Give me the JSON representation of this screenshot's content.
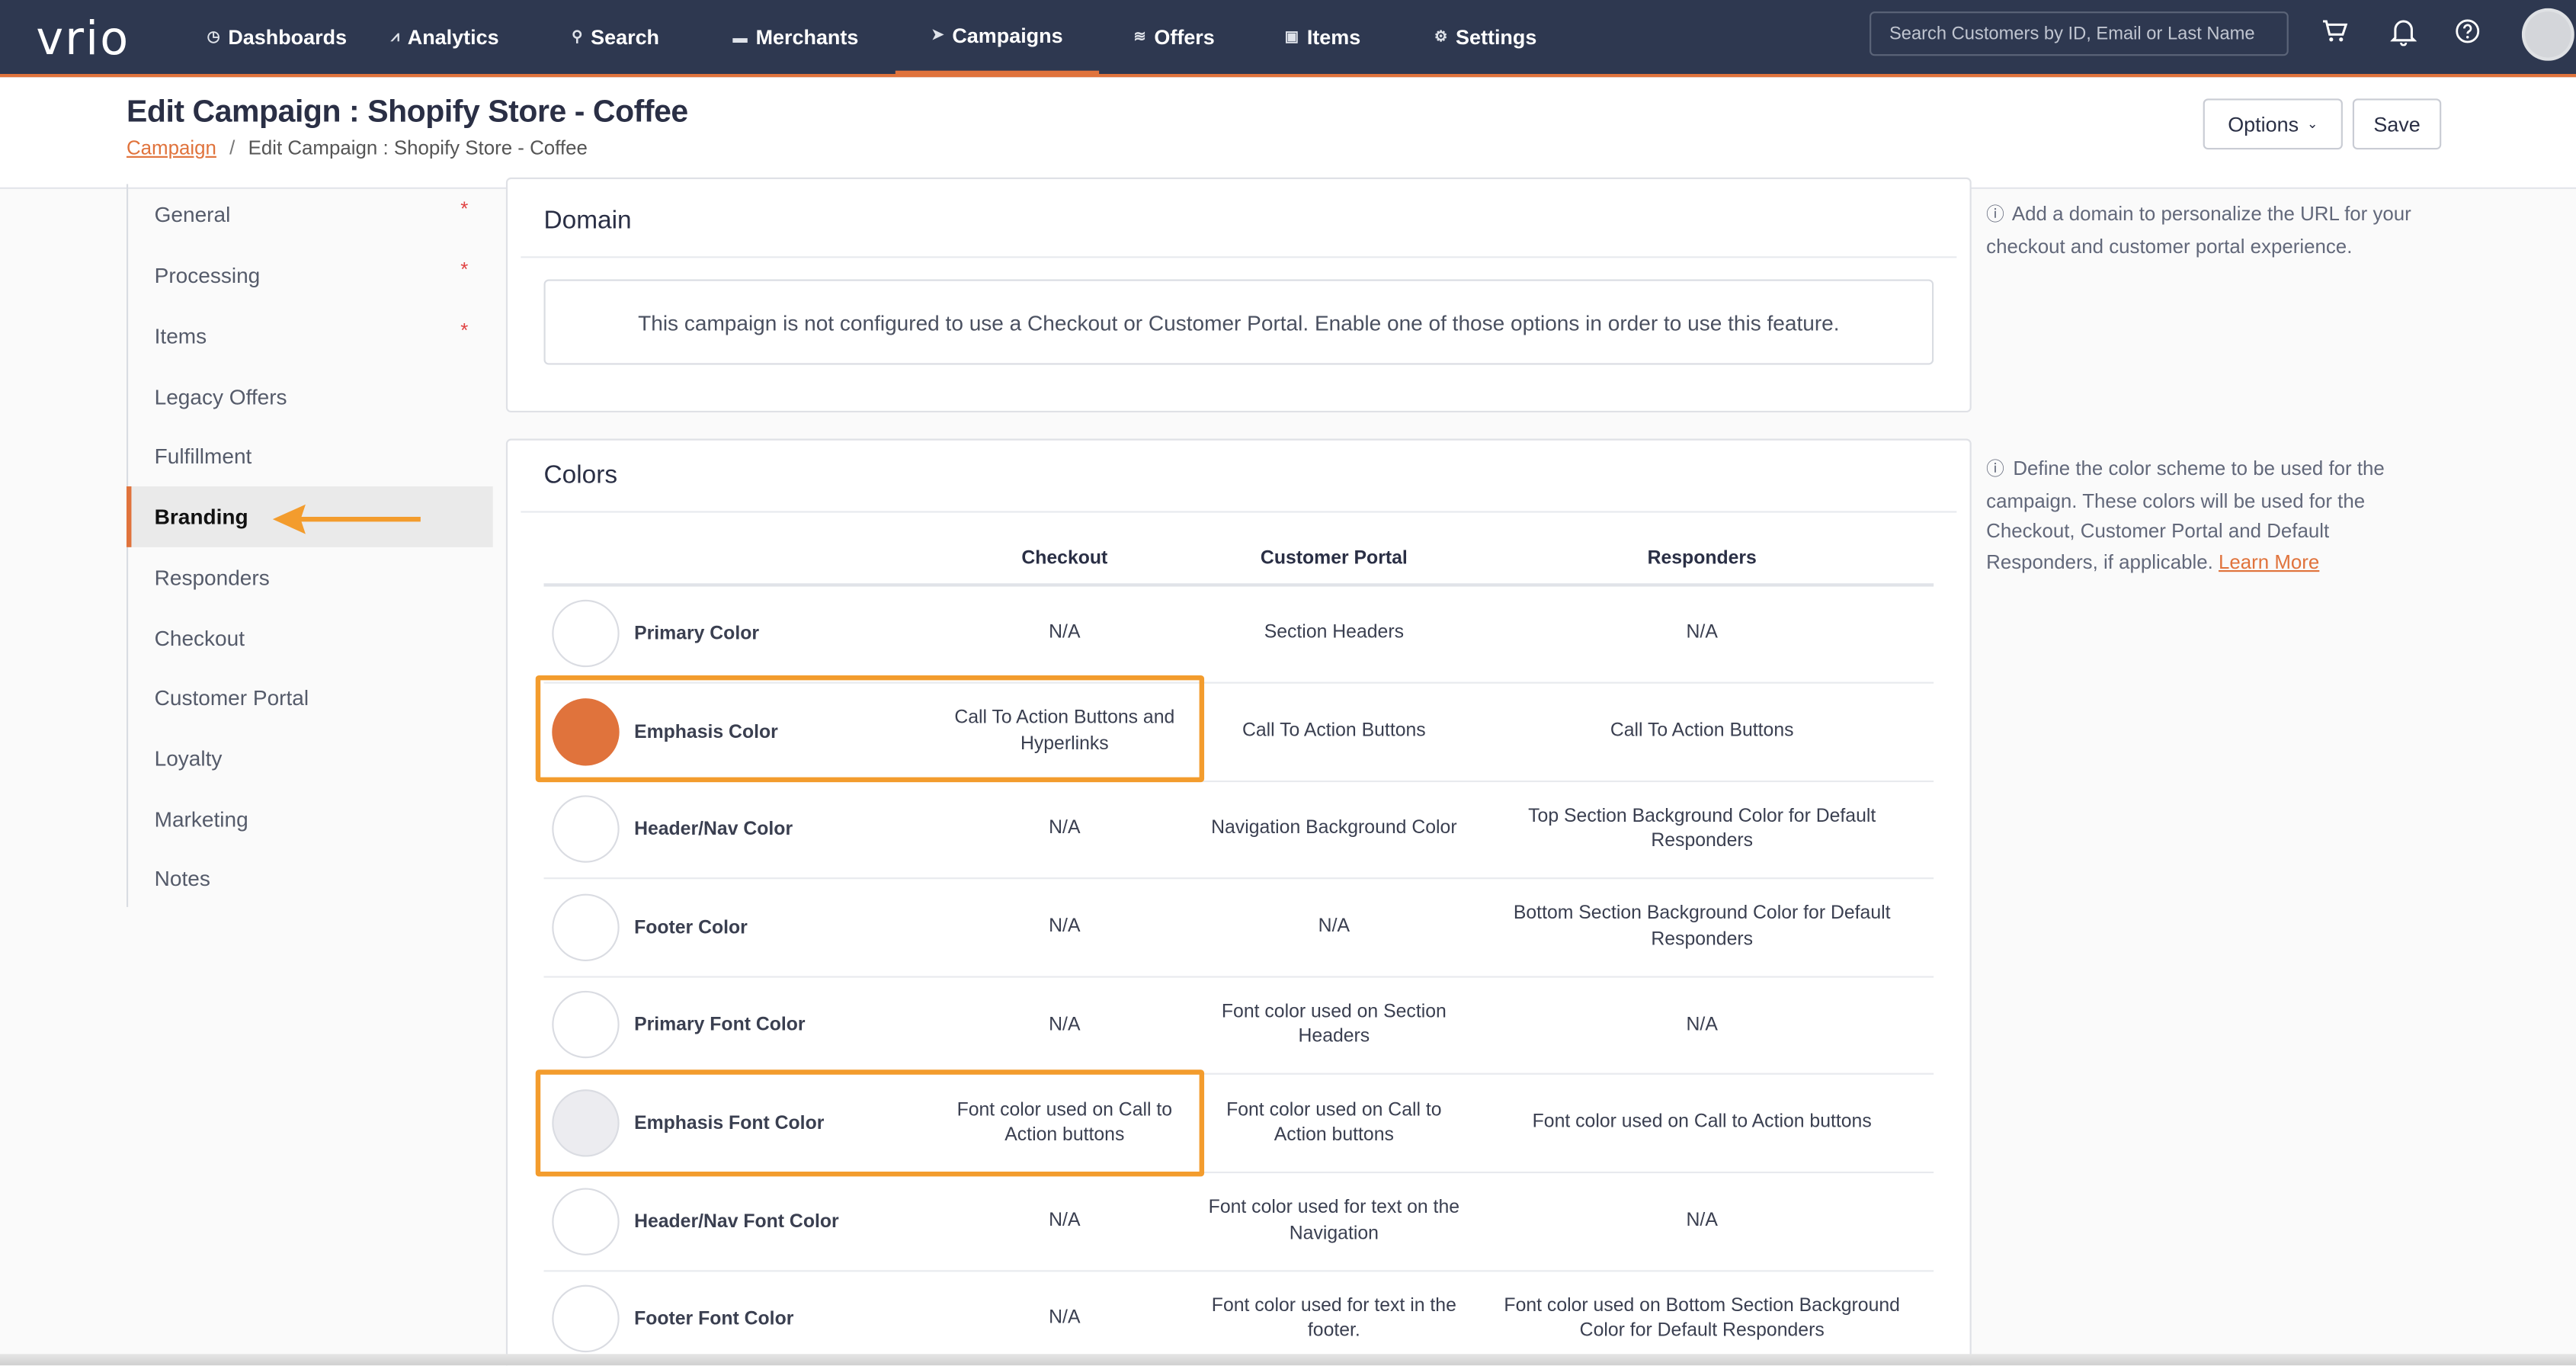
{
  "nav": {
    "logo": "vrio",
    "items": [
      {
        "label": "Dashboards",
        "icon": "dashboard-icon"
      },
      {
        "label": "Analytics",
        "icon": "chart-icon"
      },
      {
        "label": "Search",
        "icon": "search-icon"
      },
      {
        "label": "Merchants",
        "icon": "card-icon"
      },
      {
        "label": "Campaigns",
        "icon": "send-icon",
        "active": true
      },
      {
        "label": "Offers",
        "icon": "layers-icon"
      },
      {
        "label": "Items",
        "icon": "box-icon"
      },
      {
        "label": "Settings",
        "icon": "gears-icon"
      }
    ],
    "search_placeholder": "Search Customers by ID, Email or Last Name",
    "accent_color": "#e0733c",
    "bg_color": "#2e3850"
  },
  "header": {
    "title": "Edit Campaign : Shopify Store - Coffee",
    "breadcrumb_link": "Campaign",
    "breadcrumb_sep": "/",
    "breadcrumb_current": "Edit Campaign : Shopify Store - Coffee",
    "options_label": "Options",
    "save_label": "Save"
  },
  "sidebar": {
    "items": [
      {
        "label": "General",
        "required": "*"
      },
      {
        "label": "Processing",
        "required": "*"
      },
      {
        "label": "Items",
        "required": "*"
      },
      {
        "label": "Legacy Offers"
      },
      {
        "label": "Fulfillment"
      },
      {
        "label": "Branding",
        "active": true
      },
      {
        "label": "Responders"
      },
      {
        "label": "Checkout"
      },
      {
        "label": "Customer Portal"
      },
      {
        "label": "Loyalty"
      },
      {
        "label": "Marketing"
      },
      {
        "label": "Notes"
      }
    ]
  },
  "domain": {
    "title": "Domain",
    "notice": "This campaign is not configured to use a Checkout or Customer Portal. Enable one of those options in order to use this feature.",
    "help": "Add a domain to personalize the URL for your checkout and customer portal experience."
  },
  "colors": {
    "title": "Colors",
    "help": "Define the color scheme to be used for the campaign. These colors will be used for the Checkout, Customer Portal and Default Responders, if applicable.",
    "learn_more": "Learn More",
    "columns": [
      "Checkout",
      "Customer Portal",
      "Responders"
    ],
    "rows": [
      {
        "name": "Primary Color",
        "swatch": "#ffffff",
        "checkout": "N/A",
        "portal": "Section Headers",
        "responders": "N/A"
      },
      {
        "name": "Emphasis Color",
        "swatch": "#e0733c",
        "checkout": "Call To Action Buttons and Hyperlinks",
        "portal": "Call To Action Buttons",
        "responders": "Call To Action Buttons"
      },
      {
        "name": "Header/Nav Color",
        "swatch": "#ffffff",
        "checkout": "N/A",
        "portal": "Navigation Background Color",
        "responders": "Top Section Background Color for Default Responders"
      },
      {
        "name": "Footer Color",
        "swatch": "#ffffff",
        "checkout": "N/A",
        "portal": "N/A",
        "responders": "Bottom Section Background Color for Default Responders"
      },
      {
        "name": "Primary Font Color",
        "swatch": "#ffffff",
        "checkout": "N/A",
        "portal": "Font color used on Section Headers",
        "responders": "N/A"
      },
      {
        "name": "Emphasis Font Color",
        "swatch": "#ececf0",
        "checkout": "Font color used on Call to Action buttons",
        "portal": "Font color used on Call to Action buttons",
        "responders": "Font color used on Call to Action buttons"
      },
      {
        "name": "Header/Nav Font Color",
        "swatch": "#ffffff",
        "checkout": "N/A",
        "portal": "Font color used for text on the Navigation",
        "responders": "N/A"
      },
      {
        "name": "Footer Font Color",
        "swatch": "#ffffff",
        "checkout": "N/A",
        "portal": "Font color used for text in the footer.",
        "responders": "Font color used on Bottom Section Background Color for Default Responders"
      }
    ]
  },
  "annotation_color": "#f39c2d"
}
